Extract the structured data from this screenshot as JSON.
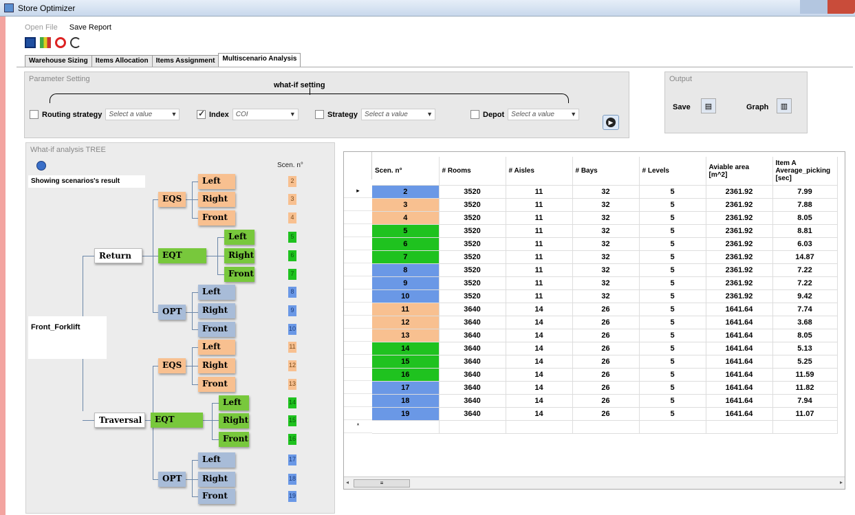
{
  "window": {
    "title": "Store Optimizer"
  },
  "menu": {
    "open_file": "Open File",
    "save_report": "Save Report"
  },
  "toolbar": {
    "icons": [
      "save-icon",
      "chart-icon",
      "stop-icon",
      "undo-icon"
    ]
  },
  "tabs": [
    {
      "label": "Warehouse Sizing",
      "active": false
    },
    {
      "label": "Items Allocation",
      "active": false
    },
    {
      "label": "Items Assignment",
      "active": false
    },
    {
      "label": "Multiscenario Analysis",
      "active": true
    }
  ],
  "parameter_setting": {
    "title": "Parameter Setting",
    "whatif_label": "what-if setting",
    "params": [
      {
        "label": "Routing strategy",
        "checked": false,
        "value": "Select a value"
      },
      {
        "label": "Index",
        "checked": true,
        "value": "COI"
      },
      {
        "label": "Strategy",
        "checked": false,
        "value": "Select a value"
      },
      {
        "label": "Depot",
        "checked": false,
        "value": "Select a value"
      }
    ]
  },
  "output": {
    "title": "Output",
    "save_label": "Save",
    "graph_label": "Graph"
  },
  "tree": {
    "title": "What-if analysis TREE",
    "showing": "Showing scenarios's result",
    "scen_header": "Scen. n°",
    "root": "Front_Forklift",
    "level1": [
      "Return",
      "Traversal"
    ],
    "level2": [
      "EQS",
      "EQT",
      "OPT",
      "EQS",
      "EQT",
      "OPT"
    ],
    "leaves": [
      "Left",
      "Right",
      "Front",
      "Left",
      "Right",
      "Front",
      "Left",
      "Right",
      "Front",
      "Left",
      "Right",
      "Front",
      "Left",
      "Right",
      "Front",
      "Left",
      "Right",
      "Front"
    ],
    "scenarios": [
      "2",
      "3",
      "4",
      "5",
      "6",
      "7",
      "8",
      "9",
      "10",
      "11",
      "12",
      "13",
      "14",
      "15",
      "16",
      "17",
      "18",
      "19"
    ]
  },
  "colors": {
    "orange": "#f8c090",
    "green": "#1fc21f",
    "blue": "#6a98e6"
  },
  "table": {
    "columns": [
      "Scen. n°",
      "# Rooms",
      "# Aisles",
      "# Bays",
      "# Levels",
      "Aviable area [m^2]",
      "Item A Average_picking [sec]"
    ],
    "rows": [
      {
        "scen": "2",
        "rooms": "3520",
        "aisles": "11",
        "bays": "32",
        "levels": "5",
        "area": "2361.92",
        "avg": "7.99",
        "color": "blue"
      },
      {
        "scen": "3",
        "rooms": "3520",
        "aisles": "11",
        "bays": "32",
        "levels": "5",
        "area": "2361.92",
        "avg": "7.88",
        "color": "orange"
      },
      {
        "scen": "4",
        "rooms": "3520",
        "aisles": "11",
        "bays": "32",
        "levels": "5",
        "area": "2361.92",
        "avg": "8.05",
        "color": "orange"
      },
      {
        "scen": "5",
        "rooms": "3520",
        "aisles": "11",
        "bays": "32",
        "levels": "5",
        "area": "2361.92",
        "avg": "8.81",
        "color": "green"
      },
      {
        "scen": "6",
        "rooms": "3520",
        "aisles": "11",
        "bays": "32",
        "levels": "5",
        "area": "2361.92",
        "avg": "6.03",
        "color": "green"
      },
      {
        "scen": "7",
        "rooms": "3520",
        "aisles": "11",
        "bays": "32",
        "levels": "5",
        "area": "2361.92",
        "avg": "14.87",
        "color": "green"
      },
      {
        "scen": "8",
        "rooms": "3520",
        "aisles": "11",
        "bays": "32",
        "levels": "5",
        "area": "2361.92",
        "avg": "7.22",
        "color": "blue"
      },
      {
        "scen": "9",
        "rooms": "3520",
        "aisles": "11",
        "bays": "32",
        "levels": "5",
        "area": "2361.92",
        "avg": "7.22",
        "color": "blue"
      },
      {
        "scen": "10",
        "rooms": "3520",
        "aisles": "11",
        "bays": "32",
        "levels": "5",
        "area": "2361.92",
        "avg": "9.42",
        "color": "blue"
      },
      {
        "scen": "11",
        "rooms": "3640",
        "aisles": "14",
        "bays": "26",
        "levels": "5",
        "area": "1641.64",
        "avg": "7.74",
        "color": "orange"
      },
      {
        "scen": "12",
        "rooms": "3640",
        "aisles": "14",
        "bays": "26",
        "levels": "5",
        "area": "1641.64",
        "avg": "3.68",
        "color": "orange"
      },
      {
        "scen": "13",
        "rooms": "3640",
        "aisles": "14",
        "bays": "26",
        "levels": "5",
        "area": "1641.64",
        "avg": "8.05",
        "color": "orange"
      },
      {
        "scen": "14",
        "rooms": "3640",
        "aisles": "14",
        "bays": "26",
        "levels": "5",
        "area": "1641.64",
        "avg": "5.13",
        "color": "green"
      },
      {
        "scen": "15",
        "rooms": "3640",
        "aisles": "14",
        "bays": "26",
        "levels": "5",
        "area": "1641.64",
        "avg": "5.25",
        "color": "green"
      },
      {
        "scen": "16",
        "rooms": "3640",
        "aisles": "14",
        "bays": "26",
        "levels": "5",
        "area": "1641.64",
        "avg": "11.59",
        "color": "green"
      },
      {
        "scen": "17",
        "rooms": "3640",
        "aisles": "14",
        "bays": "26",
        "levels": "5",
        "area": "1641.64",
        "avg": "11.82",
        "color": "blue"
      },
      {
        "scen": "18",
        "rooms": "3640",
        "aisles": "14",
        "bays": "26",
        "levels": "5",
        "area": "1641.64",
        "avg": "7.94",
        "color": "blue"
      },
      {
        "scen": "19",
        "rooms": "3640",
        "aisles": "14",
        "bays": "26",
        "levels": "5",
        "area": "1641.64",
        "avg": "11.07",
        "color": "blue"
      }
    ],
    "current_row_marker": "▸",
    "new_row_marker": "*"
  }
}
